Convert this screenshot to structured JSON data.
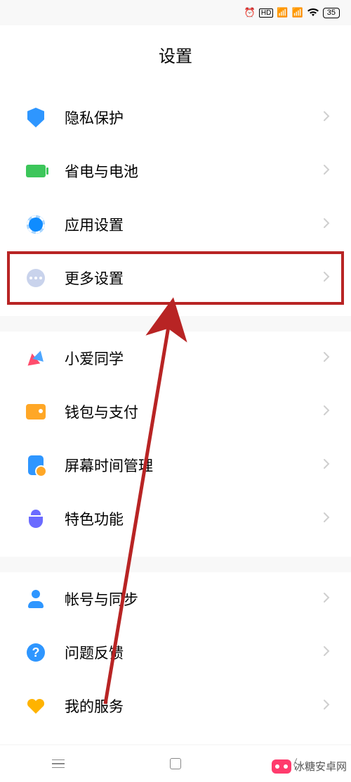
{
  "statusBar": {
    "battery": "35"
  },
  "page": {
    "title": "设置"
  },
  "groups": [
    {
      "items": [
        {
          "key": "privacy",
          "icon": "ic-shield",
          "label": "隐私保护"
        },
        {
          "key": "battery",
          "icon": "ic-battery",
          "label": "省电与电池"
        },
        {
          "key": "apps",
          "icon": "ic-gear",
          "label": "应用设置"
        },
        {
          "key": "more",
          "icon": "ic-more",
          "label": "更多设置",
          "highlighted": true
        }
      ]
    },
    {
      "items": [
        {
          "key": "xiaoai",
          "icon": "ic-ai",
          "label": "小爱同学"
        },
        {
          "key": "wallet",
          "icon": "ic-wallet",
          "label": "钱包与支付"
        },
        {
          "key": "screentime",
          "icon": "ic-screen",
          "label": "屏幕时间管理"
        },
        {
          "key": "special",
          "icon": "ic-special",
          "label": "特色功能"
        }
      ]
    },
    {
      "items": [
        {
          "key": "account",
          "icon": "ic-account",
          "label": "帐号与同步"
        },
        {
          "key": "feedback",
          "icon": "ic-question",
          "label": "问题反馈"
        },
        {
          "key": "service",
          "icon": "ic-heart",
          "label": "我的服务"
        }
      ]
    }
  ],
  "watermark": {
    "text": "冰糖安卓网"
  },
  "annotation": {
    "highlightColor": "#b82424"
  }
}
